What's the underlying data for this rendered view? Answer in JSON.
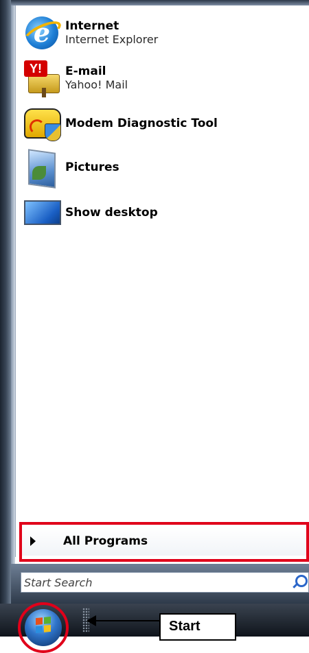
{
  "start_menu": {
    "pinned_items": [
      {
        "title": "Internet",
        "subtitle": "Internet Explorer",
        "icon": "internet-explorer-icon"
      },
      {
        "title": "E-mail",
        "subtitle": "Yahoo! Mail",
        "icon": "yahoo-mail-icon"
      },
      {
        "title": "Modem Diagnostic Tool",
        "subtitle": "",
        "icon": "modem-diagnostic-icon"
      },
      {
        "title": "Pictures",
        "subtitle": "",
        "icon": "pictures-icon"
      },
      {
        "title": "Show desktop",
        "subtitle": "",
        "icon": "show-desktop-icon"
      }
    ],
    "all_programs_label": "All Programs",
    "search": {
      "placeholder": "Start Search",
      "icon": "search-icon"
    }
  },
  "taskbar": {
    "start_orb_icon": "windows-start-orb-icon",
    "annotation_label": "Start",
    "highlight_color": "#e0001a"
  }
}
